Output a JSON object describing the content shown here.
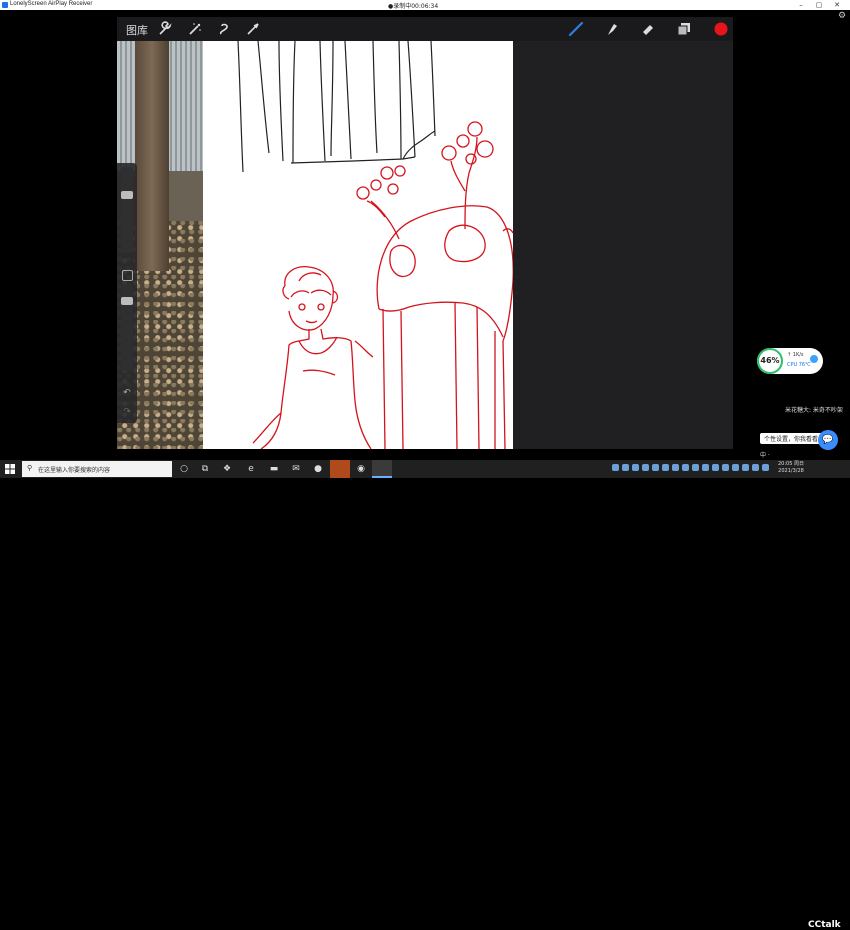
{
  "window": {
    "title": "LonelyScreen AirPlay Receiver",
    "recording": "●录制中00:06:34",
    "minimize": "–",
    "maximize": "▢",
    "close": "✕"
  },
  "procreate": {
    "gallery_label": "图库",
    "toolbar_icons": [
      "wrench-icon",
      "magic-wand-icon",
      "selection-icon",
      "transform-icon"
    ],
    "right_tools": [
      "brush-icon",
      "smudge-icon",
      "eraser-icon",
      "layers-icon",
      "color-swatch"
    ],
    "active_color": "#e8141c",
    "brush_color": "#2f7fe0",
    "undo": "↶",
    "redo": "↷"
  },
  "overlay": {
    "cpu_percent": "46%",
    "speed": "↑ 1K/s",
    "cpu_temp": "CPU 76℃",
    "notification": "米花糖大: 米奇不吵架",
    "bubble": "个性设置，你我看看",
    "ime": "中 ·"
  },
  "taskbar": {
    "search_placeholder": "在这里输入你要搜索的内容",
    "clock_time": "20:05 周日",
    "clock_date": "2021/3/28",
    "watermark": "CCtalk"
  }
}
